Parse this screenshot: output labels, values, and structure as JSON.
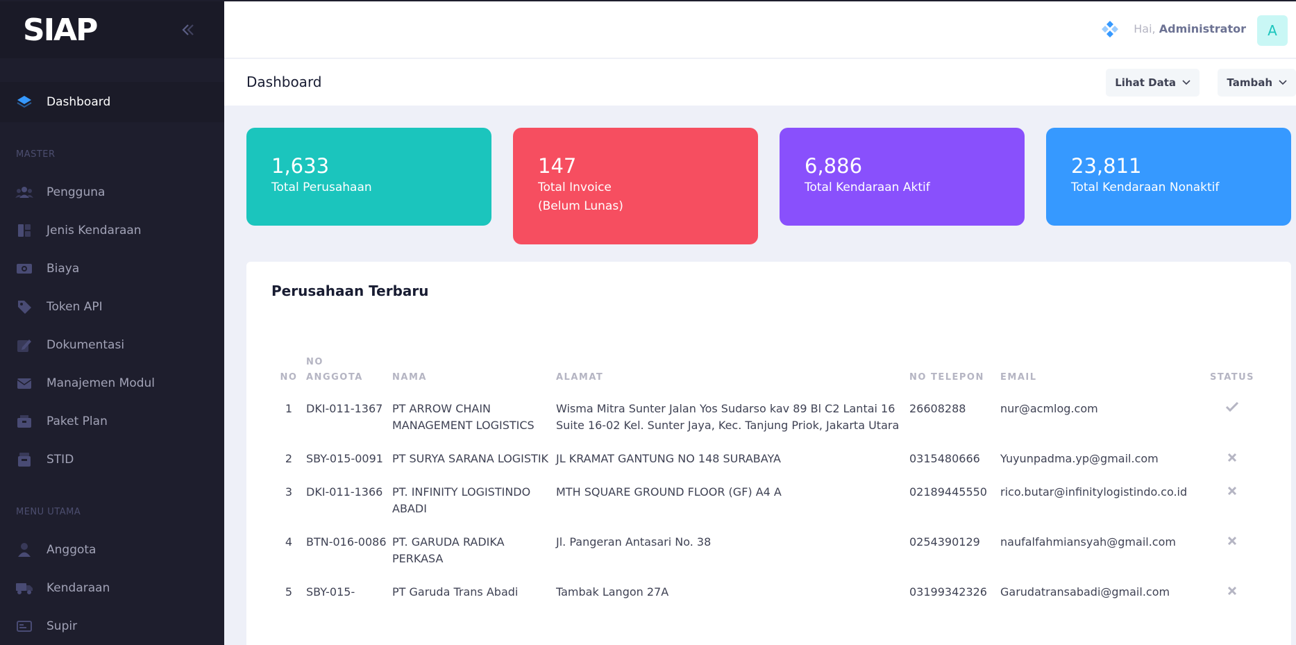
{
  "app": {
    "logo": "SIAP"
  },
  "sidebar": {
    "active": {
      "label": "Dashboard"
    },
    "section_master": "MASTER",
    "master_items": [
      {
        "label": "Pengguna",
        "icon": "users-icon"
      },
      {
        "label": "Jenis Kendaraan",
        "icon": "category-icon"
      },
      {
        "label": "Biaya",
        "icon": "money-icon"
      },
      {
        "label": "Token API",
        "icon": "tag-icon"
      },
      {
        "label": "Dokumentasi",
        "icon": "edit-icon"
      },
      {
        "label": "Manajemen Modul",
        "icon": "mail-icon"
      },
      {
        "label": "Paket Plan",
        "icon": "package-icon"
      },
      {
        "label": "STID",
        "icon": "box-icon"
      }
    ],
    "section_utama": "MENU UTAMA",
    "utama_items": [
      {
        "label": "Anggota",
        "icon": "user-icon"
      },
      {
        "label": "Kendaraan",
        "icon": "truck-icon"
      },
      {
        "label": "Supir",
        "icon": "id-card-icon"
      }
    ]
  },
  "header": {
    "greeting": "Hai,",
    "user": "Administrator",
    "avatar_letter": "A"
  },
  "subheader": {
    "title": "Dashboard",
    "lihat_data": "Lihat Data",
    "tambah": "Tambah"
  },
  "stats": [
    {
      "value": "1,633",
      "label": "Total Perusahaan",
      "color": "#1bc5bd"
    },
    {
      "value": "147",
      "label": "Total Invoice",
      "label2": "(Belum Lunas)",
      "color": "#f64e60"
    },
    {
      "value": "6,886",
      "label": "Total Kendaraan Aktif",
      "color": "#8950fc"
    },
    {
      "value": "23,811",
      "label": "Total Kendaraan Nonaktif",
      "color": "#3699ff"
    }
  ],
  "table": {
    "title": "Perusahaan Terbaru",
    "headers": {
      "no": "NO",
      "anggota1": "NO",
      "anggota2": "ANGGOTA",
      "nama": "NAMA",
      "alamat": "ALAMAT",
      "telepon": "NO TELEPON",
      "email": "EMAIL",
      "status": "STATUS"
    },
    "rows": [
      {
        "no": "1",
        "anggota": "DKI-011-1367",
        "nama": "PT ARROW CHAIN MANAGEMENT LOGISTICS",
        "alamat": "Wisma Mitra Sunter Jalan Yos Sudarso kav 89 Bl C2 Lantai 16 Suite 16-02 Kel. Sunter Jaya, Kec. Tanjung Priok, Jakarta Utara",
        "telepon": "26608288",
        "email": "nur@acmlog.com",
        "status": "check"
      },
      {
        "no": "2",
        "anggota": "SBY-015-0091",
        "nama": "PT SURYA SARANA LOGISTIK",
        "alamat": "JL KRAMAT GANTUNG NO 148 SURABAYA",
        "telepon": "0315480666",
        "email": "Yuyunpadma.yp@gmail.com",
        "status": "cross"
      },
      {
        "no": "3",
        "anggota": "DKI-011-1366",
        "nama": "PT. INFINITY LOGISTINDO ABADI",
        "alamat": "MTH SQUARE GROUND FLOOR (GF) A4 A",
        "telepon": "02189445550",
        "email": "rico.butar@infinitylogistindo.co.id",
        "status": "cross"
      },
      {
        "no": "4",
        "anggota": "BTN-016-0086",
        "nama": "PT. GARUDA RADIKA PERKASA",
        "alamat": "Jl. Pangeran Antasari No. 38",
        "telepon": "0254390129",
        "email": "naufalfahmiansyah@gmail.com",
        "status": "cross"
      },
      {
        "no": "5",
        "anggota": "SBY-015-",
        "nama": "PT Garuda Trans Abadi",
        "alamat": "Tambak Langon 27A",
        "telepon": "03199342326",
        "email": "Garudatransabadi@gmail.com",
        "status": "cross"
      }
    ]
  }
}
